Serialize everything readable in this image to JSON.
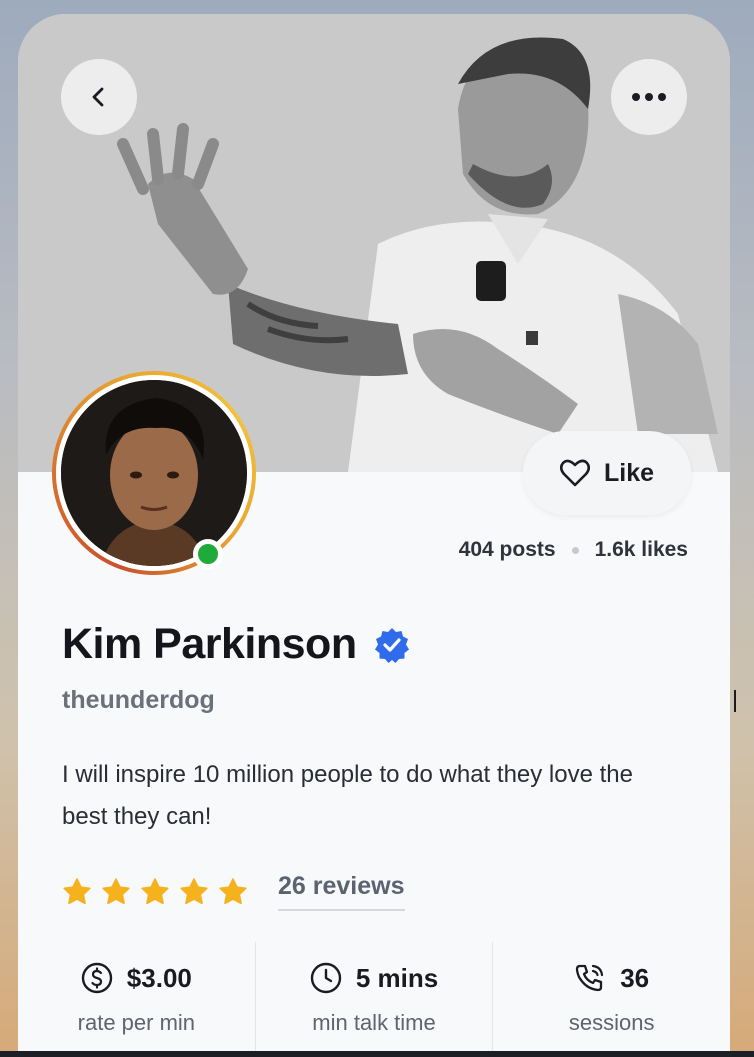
{
  "header": {
    "back_icon": "chevron-left-icon",
    "more_icon": "more-horizontal-icon"
  },
  "like_button": {
    "label": "Like",
    "icon": "heart-icon"
  },
  "stats": {
    "posts": "404 posts",
    "likes": "1.6k likes"
  },
  "profile": {
    "name": "Kim Parkinson",
    "verified_icon": "verified-badge-icon",
    "handle": "theunderdog",
    "bio": "I will inspire 10 million people to do what they love the best they can!",
    "online": true
  },
  "rating": {
    "stars": 5,
    "reviews": "26 reviews"
  },
  "metrics": [
    {
      "icon": "dollar-icon",
      "value": "$3.00",
      "label": "rate per min"
    },
    {
      "icon": "clock-icon",
      "value": "5 mins",
      "label": "min talk time"
    },
    {
      "icon": "phone-icon",
      "value": "36",
      "label": "sessions"
    }
  ],
  "colors": {
    "star": "#F5B21D",
    "verified": "#2F6BEA",
    "online": "#1FAA3A"
  }
}
